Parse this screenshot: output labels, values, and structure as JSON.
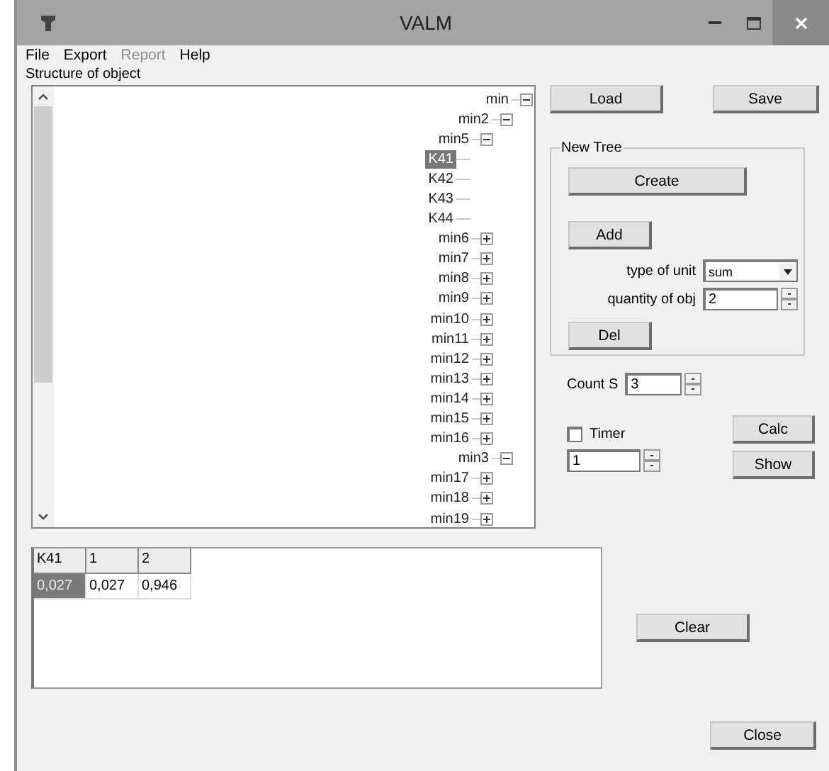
{
  "window": {
    "title": "VALM"
  },
  "menu": [
    {
      "label": "File",
      "disabled": false
    },
    {
      "label": "Export",
      "disabled": false
    },
    {
      "label": "Report",
      "disabled": true
    },
    {
      "label": "Help",
      "disabled": false
    }
  ],
  "tree_label": "Structure of object",
  "tree": [
    {
      "label": "min",
      "kind": "group",
      "expanded": true,
      "selected": false,
      "children": [
        {
          "label": "min2",
          "kind": "group",
          "expanded": true,
          "selected": false,
          "children": [
            {
              "label": "min5",
              "kind": "group",
              "expanded": true,
              "selected": false,
              "children": [
                {
                  "label": "K41",
                  "kind": "leaf",
                  "selected": true
                },
                {
                  "label": "K42",
                  "kind": "leaf",
                  "selected": false
                },
                {
                  "label": "K43",
                  "kind": "leaf",
                  "selected": false
                },
                {
                  "label": "K44",
                  "kind": "leaf",
                  "selected": false
                }
              ]
            },
            {
              "label": "min6",
              "kind": "group",
              "expanded": false,
              "selected": false
            },
            {
              "label": "min7",
              "kind": "group",
              "expanded": false,
              "selected": false
            },
            {
              "label": "min8",
              "kind": "group",
              "expanded": false,
              "selected": false
            },
            {
              "label": "min9",
              "kind": "group",
              "expanded": false,
              "selected": false
            },
            {
              "label": "min10",
              "kind": "group",
              "expanded": false,
              "selected": false
            },
            {
              "label": "min11",
              "kind": "group",
              "expanded": false,
              "selected": false
            },
            {
              "label": "min12",
              "kind": "group",
              "expanded": false,
              "selected": false
            },
            {
              "label": "min13",
              "kind": "group",
              "expanded": false,
              "selected": false
            },
            {
              "label": "min14",
              "kind": "group",
              "expanded": false,
              "selected": false
            },
            {
              "label": "min15",
              "kind": "group",
              "expanded": false,
              "selected": false
            },
            {
              "label": "min16",
              "kind": "group",
              "expanded": false,
              "selected": false
            }
          ]
        },
        {
          "label": "min3",
          "kind": "group",
          "expanded": true,
          "selected": false,
          "children": [
            {
              "label": "min17",
              "kind": "group",
              "expanded": false,
              "selected": false
            },
            {
              "label": "min18",
              "kind": "group",
              "expanded": false,
              "selected": false
            },
            {
              "label": "min19",
              "kind": "group",
              "expanded": false,
              "selected": false
            }
          ]
        }
      ]
    }
  ],
  "load_button": "Load",
  "save_button": "Save",
  "new_tree": {
    "title": "New Tree",
    "create_button": "Create",
    "add_button": "Add",
    "type_of_unit": {
      "label": "type of unit",
      "value": "sum"
    },
    "quantity_of_obj": {
      "label": "quantity of obj",
      "value": "2"
    },
    "del_button": "Del"
  },
  "count_s": {
    "label": "Count S",
    "value": "3"
  },
  "timer": {
    "label": "Timer",
    "checked": false,
    "value": "1"
  },
  "calc_button": "Calc",
  "show_button": "Show",
  "grid": {
    "columns": [
      "K41",
      "1",
      "2"
    ],
    "rows": [
      [
        {
          "text": "0,027",
          "selected": true
        },
        {
          "text": "0,027",
          "selected": false
        },
        {
          "text": "0,946",
          "selected": false
        }
      ]
    ]
  },
  "clear_button": "Clear",
  "close_button": "Close"
}
